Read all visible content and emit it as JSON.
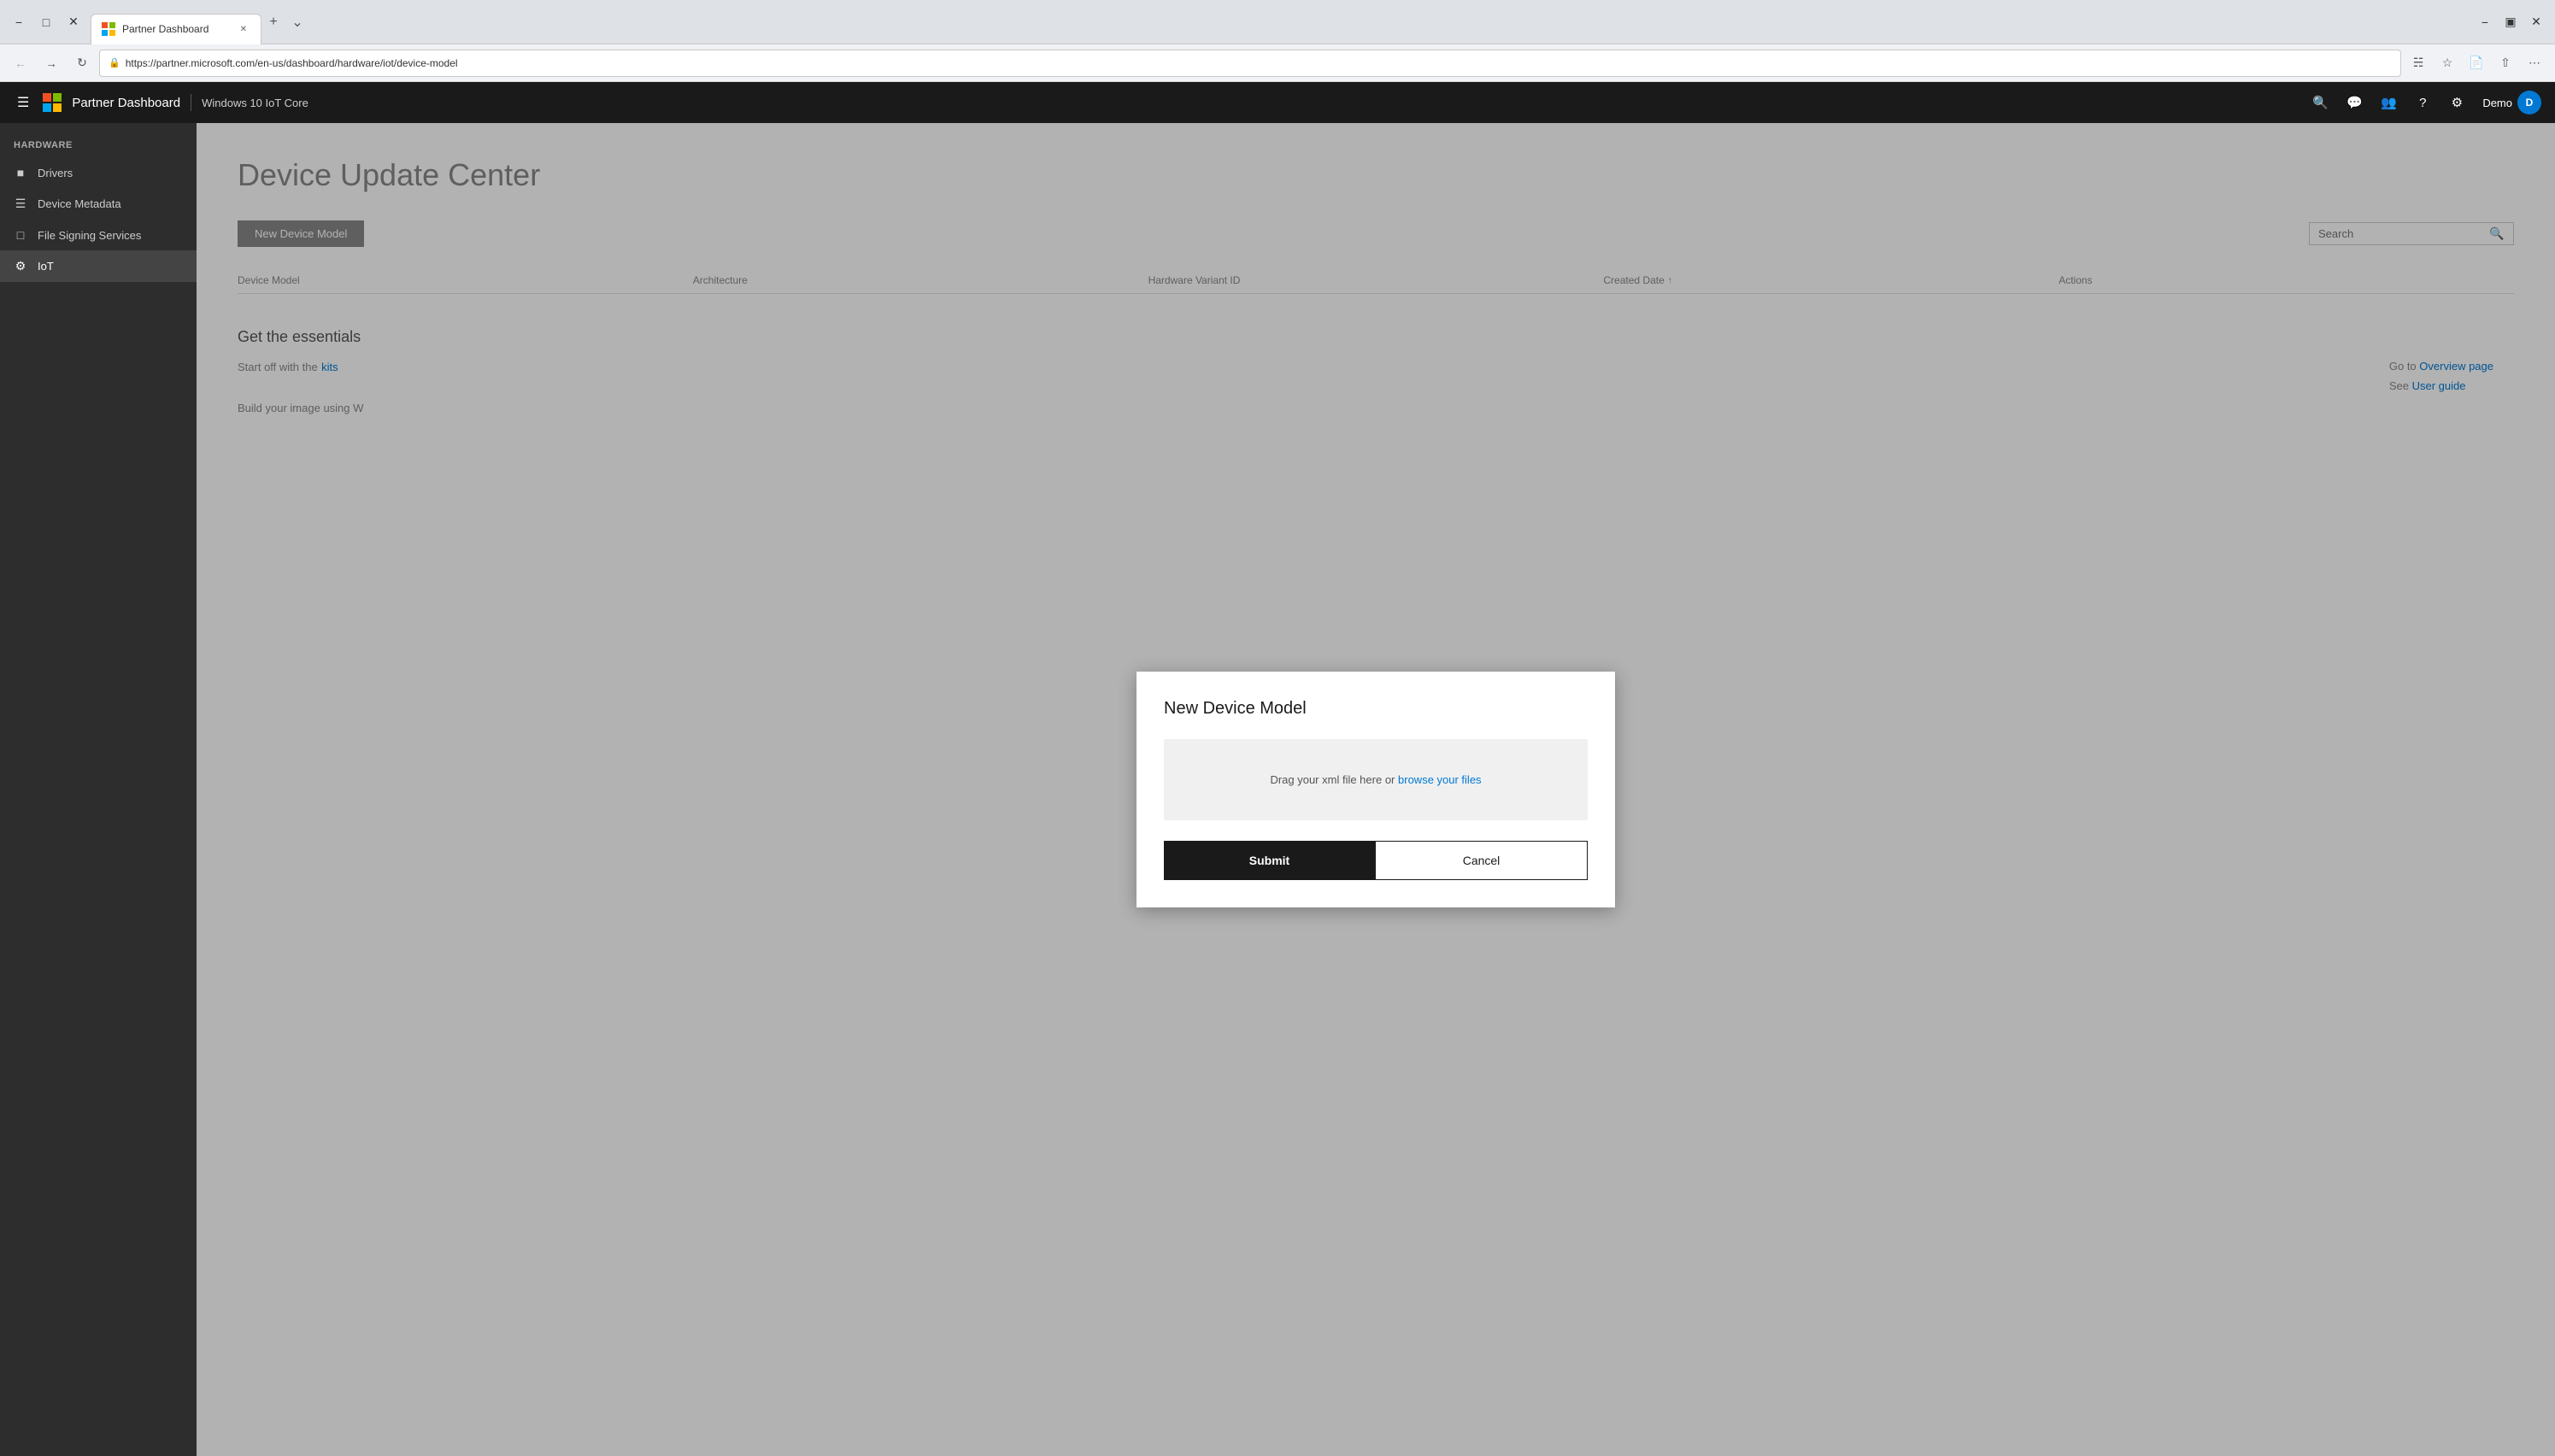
{
  "browser": {
    "address": "https://partner.microsoft.com/en-us/dashboard/hardware/iot/device-model",
    "tab_title": "Partner Dashboard",
    "new_tab_icon": "+",
    "dropdown_icon": "⌄"
  },
  "topbar": {
    "app_title": "Partner Dashboard",
    "sub_title": "Windows 10 IoT Core",
    "user_name": "Demo",
    "user_initial": "D"
  },
  "sidebar": {
    "section_label": "HARDWARE",
    "items": [
      {
        "id": "drivers",
        "label": "Drivers",
        "icon": "⊞"
      },
      {
        "id": "device-metadata",
        "label": "Device Metadata",
        "icon": "≡"
      },
      {
        "id": "file-signing",
        "label": "File Signing Services",
        "icon": "⊟"
      },
      {
        "id": "iot",
        "label": "IoT",
        "icon": "⚙"
      }
    ]
  },
  "page": {
    "title": "Device Update Center",
    "new_model_button": "New Device Model",
    "search_placeholder": "Search",
    "table": {
      "columns": [
        {
          "id": "device-model",
          "label": "Device Model"
        },
        {
          "id": "architecture",
          "label": "Architecture"
        },
        {
          "id": "hardware-variant",
          "label": "Hardware Variant ID"
        },
        {
          "id": "created-date",
          "label": "Created Date"
        },
        {
          "id": "actions",
          "label": "Actions"
        }
      ]
    },
    "empty_state": {
      "title": "Get the essentials",
      "start_text": "Start off with the",
      "kits_link": "kits",
      "build_text": "Build your image using W",
      "right_links": [
        {
          "prefix": "Go to",
          "link_text": "Overview page"
        },
        {
          "prefix": "See",
          "link_text": "User guide"
        }
      ]
    }
  },
  "modal": {
    "title": "New Device Model",
    "drop_text": "Drag your xml file here or",
    "browse_link": "browse your files",
    "submit_label": "Submit",
    "cancel_label": "Cancel"
  }
}
